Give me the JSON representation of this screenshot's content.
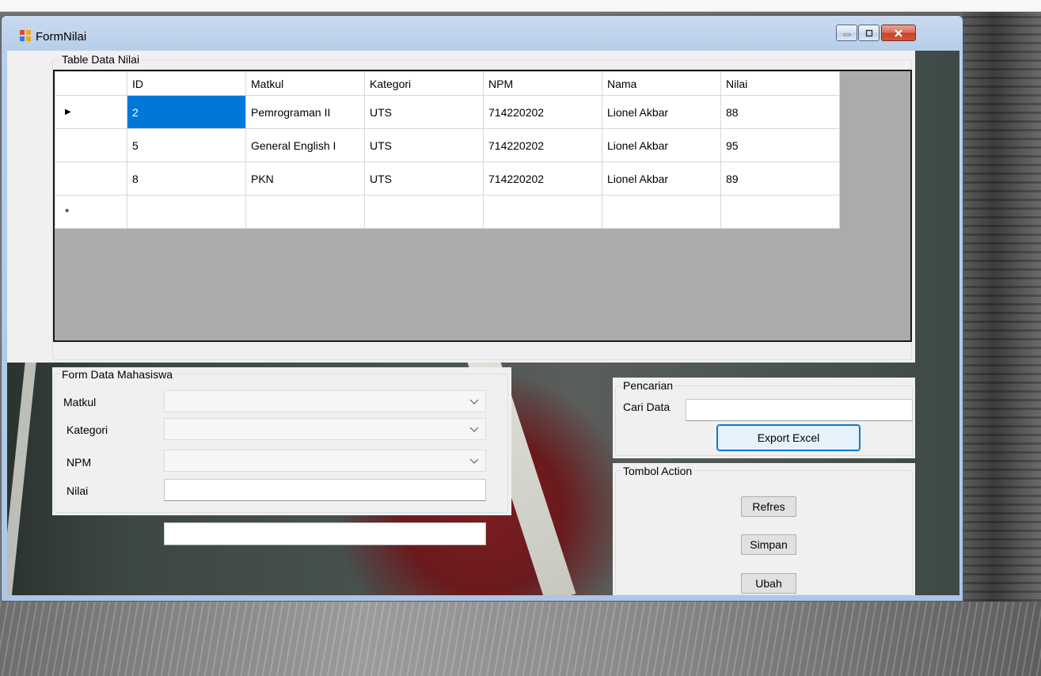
{
  "window": {
    "title": "FormNilai"
  },
  "table_group": {
    "legend": "Table Data Nilai"
  },
  "grid": {
    "columns": [
      "ID",
      "Matkul",
      "Kategori",
      "NPM",
      "Nama",
      "Nilai"
    ],
    "rows": [
      {
        "indicator": "▶",
        "cells": [
          "2",
          "Pemrograman II",
          "UTS",
          "714220202",
          "Lionel Akbar",
          "88"
        ]
      },
      {
        "indicator": "",
        "cells": [
          "5",
          "General English I",
          "UTS",
          "714220202",
          "Lionel Akbar",
          "95"
        ]
      },
      {
        "indicator": "",
        "cells": [
          "8",
          "PKN",
          "UTS",
          "714220202",
          "Lionel Akbar",
          "89"
        ]
      },
      {
        "indicator": "*",
        "cells": [
          "",
          "",
          "",
          "",
          "",
          ""
        ]
      }
    ],
    "selection_color": "#0078d7"
  },
  "form_group": {
    "legend": "Form Data Mahasiswa",
    "matkul_label": "Matkul",
    "kategori_label": "Kategori",
    "npm_label": "NPM",
    "nilai_label": "Nilai",
    "matkul_value": "",
    "kategori_value": "",
    "npm_value": "",
    "nilai_value": ""
  },
  "extra_textbox_value": "",
  "search_group": {
    "legend": "Pencarian",
    "cari_label": "Cari Data",
    "cari_value": "",
    "export_label": "Export Excel"
  },
  "action_group": {
    "legend": "Tombol Action",
    "refresh_label": "Refres",
    "save_label": "Simpan",
    "edit_label": "Ubah"
  },
  "icons": {
    "app": "form-icon",
    "minimize": "minimize-icon",
    "maximize": "maximize-icon",
    "close": "close-icon",
    "dropdown": "chevron-down-icon"
  }
}
